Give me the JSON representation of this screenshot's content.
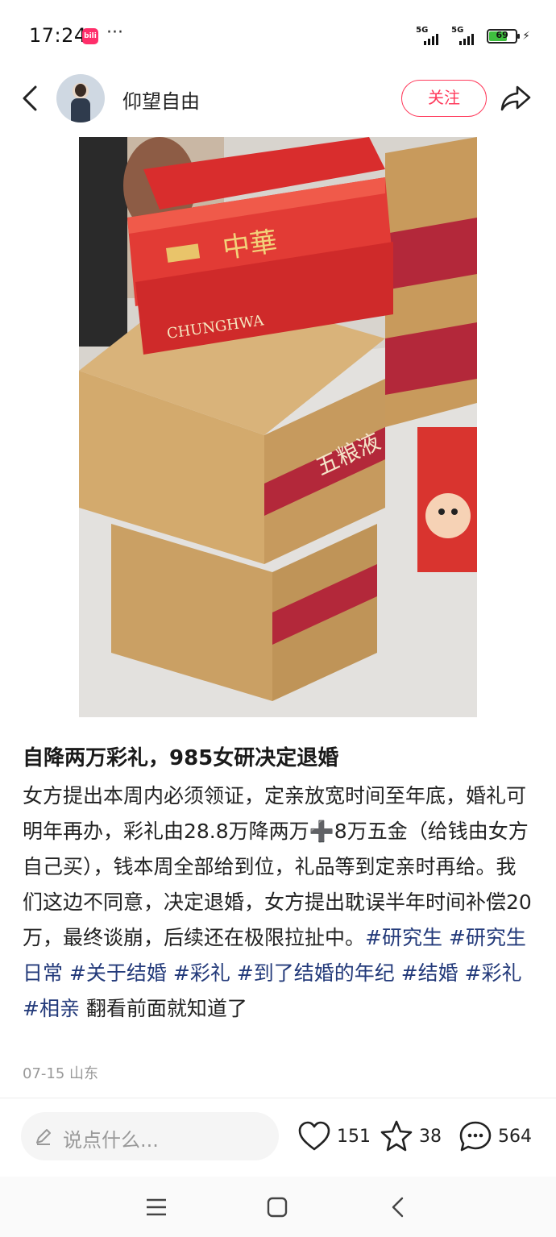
{
  "status_bar": {
    "time": "17:24",
    "app_badge": "bilibili",
    "overflow": "···",
    "net1": "5G",
    "net2": "5G",
    "battery": "69",
    "battery_level": 0.69
  },
  "header": {
    "username": "仰望自由",
    "follow_label": "关注",
    "icons": [
      "back-arrow-icon",
      "avatar",
      "share-icon"
    ]
  },
  "post": {
    "title": "自降两万彩礼，985女研决定退婚",
    "body": "女方提出本周内必须领证，定亲放宽时间至年底，婚礼可明年再办，彩礼由28.8万降两万➕8万五金（给钱由女方自己买），钱本周全部给到位，礼品等到定亲时再给。我们这边不同意，决定退婚，女方提出耽误半年时间补偿20万，最终谈崩，后续还在极限拉扯中。",
    "tags": [
      "#研究生",
      "#研究生日常",
      "#关于结婚",
      "#彩礼",
      "#到了结婚的年纪",
      "#结婚",
      "#彩礼",
      "#相亲"
    ],
    "tail": "翻看前面就知道了",
    "date": "07-15",
    "location": "山东",
    "photo_labels": {
      "brand_cn": "中華",
      "brand_en": "CHUNGHWA",
      "box_label": "五粮液"
    }
  },
  "actions": {
    "comment_placeholder": "说点什么...",
    "likes": "151",
    "favorites": "38",
    "comments": "564"
  },
  "colors": {
    "accent": "#ff3b5c",
    "tag": "#233a7a",
    "meta": "#999999"
  }
}
